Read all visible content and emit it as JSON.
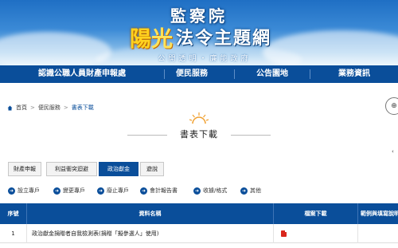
{
  "header": {
    "agency": "監察院",
    "brand_sun": "陽",
    "brand_guang": "光",
    "brand_rest": "法令主題網",
    "tagline": "公開透明・廉能政府"
  },
  "main_nav": {
    "items": [
      "認識公職人員財產申報處",
      "便民服務",
      "公告園地",
      "業務資訊"
    ]
  },
  "breadcrumb": {
    "home": "首頁",
    "section": "便民服務",
    "current": "書表下載",
    "separator": ">"
  },
  "share_label": "⊕",
  "page_title": "書表下載",
  "right_mark": "‹",
  "tabs": [
    {
      "label": "財產申報",
      "active": false
    },
    {
      "label": "利益衝突迴避",
      "active": false
    },
    {
      "label": "政治獻金",
      "active": true
    },
    {
      "label": "遊說",
      "active": false
    }
  ],
  "filters": [
    {
      "label": "設立專戶"
    },
    {
      "label": "變更專戶"
    },
    {
      "label": "廢止專戶"
    },
    {
      "label": "會計報告書"
    },
    {
      "label": "收據/格式"
    },
    {
      "label": "其他"
    }
  ],
  "table": {
    "headers": {
      "index": "序號",
      "name": "資料名稱",
      "download": "檔案下載",
      "sample": "範例與填寫說明"
    },
    "rows": [
      {
        "index": "1",
        "name": "政治獻金捐贈者自我檢測表(捐贈「擬參選人」使用)",
        "file_type": "pdf"
      }
    ]
  },
  "colors": {
    "primary": "#0a4e9a",
    "banner_top": "#1f6fc4",
    "brand_yellow": "#ffd21f",
    "pdf_red": "#d9261c"
  }
}
